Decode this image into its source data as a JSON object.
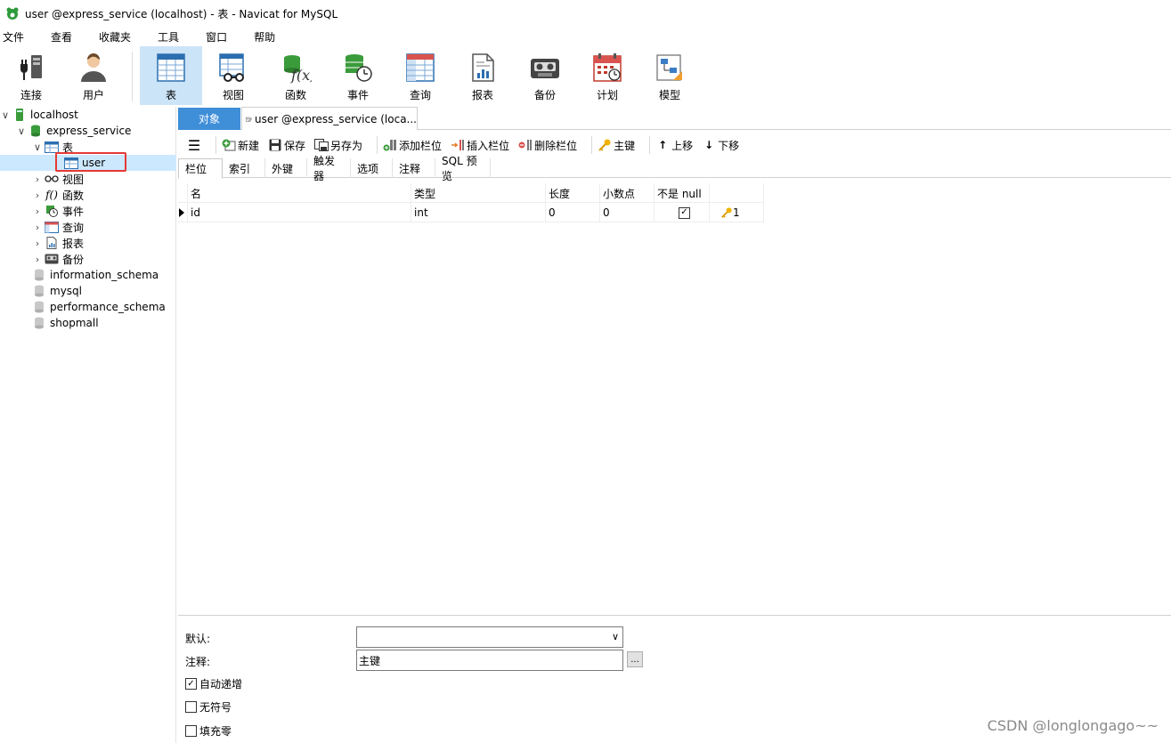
{
  "window": {
    "title": "user @express_service (localhost) - 表 - Navicat for MySQL"
  },
  "menu": [
    "文件",
    "查看",
    "收藏夹",
    "工具",
    "窗口",
    "帮助"
  ],
  "toolbar": {
    "connect": "连接",
    "user": "用户",
    "table": "表",
    "view": "视图",
    "function": "函数",
    "event": "事件",
    "query": "查询",
    "report": "报表",
    "backup": "备份",
    "schedule": "计划",
    "model": "模型"
  },
  "tree": {
    "localhost": "localhost",
    "express_service": "express_service",
    "tables": "表",
    "user": "user",
    "views": "视图",
    "functions": "函数",
    "events": "事件",
    "queries": "查询",
    "reports": "报表",
    "backups": "备份",
    "information_schema": "information_schema",
    "mysql": "mysql",
    "performance_schema": "performance_schema",
    "shopmall": "shopmall"
  },
  "doctabs": {
    "objects": "对象",
    "user_tab": "user @express_service (loca..."
  },
  "design_toolbar": {
    "new": "新建",
    "save": "保存",
    "save_as": "另存为",
    "add_field": "添加栏位",
    "insert_field": "插入栏位",
    "delete_field": "删除栏位",
    "primary_key": "主键",
    "move_up": "上移",
    "move_down": "下移"
  },
  "subtabs": [
    "栏位",
    "索引",
    "外键",
    "触发器",
    "选项",
    "注释",
    "SQL 预览"
  ],
  "grid": {
    "headers": {
      "name": "名",
      "type": "类型",
      "length": "长度",
      "decimals": "小数点",
      "not_null": "不是 null",
      "key": ""
    },
    "rows": [
      {
        "name": "id",
        "type": "int",
        "length": "0",
        "decimals": "0",
        "not_null": true,
        "key": "1"
      }
    ]
  },
  "props": {
    "default_label": "默认:",
    "default_value": "",
    "comment_label": "注释:",
    "comment_value": "主键",
    "ellipsis": "...",
    "auto_increment": "自动递增",
    "auto_increment_checked": true,
    "unsigned": "无符号",
    "unsigned_checked": false,
    "zerofill": "填充零",
    "zerofill_checked": false
  },
  "watermark": "CSDN @longlongago~~",
  "colors": {
    "accent": "#3f8ed8",
    "selection": "#cce8ff",
    "highlight_box": "#e53935",
    "toolbar_active": "#cce4f7"
  }
}
